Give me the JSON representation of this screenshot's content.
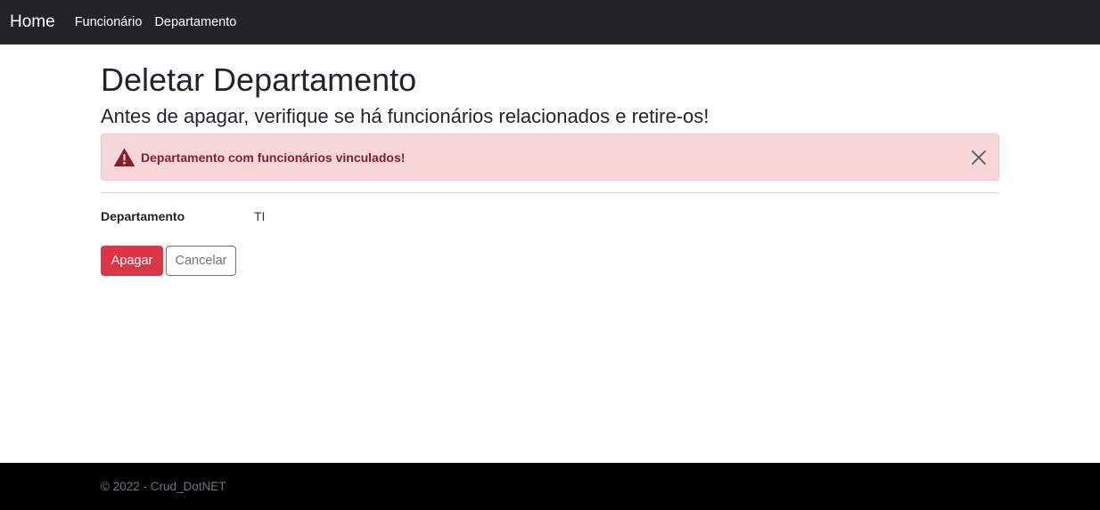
{
  "navbar": {
    "brand": "Home",
    "links": [
      "Funcionário",
      "Departamento"
    ]
  },
  "page": {
    "title": "Deletar Departamento",
    "subtitle": "Antes de apagar, verifique se há funcionários relacionados e retire-os!"
  },
  "alert": {
    "message": "Departamento com funcionários vinculados!",
    "icon": "warning-triangle-icon",
    "color": "#842029",
    "background": "#f8d7da"
  },
  "details": {
    "label": "Departamento",
    "value": "TI"
  },
  "actions": {
    "delete_label": "Apagar",
    "cancel_label": "Cancelar",
    "danger_color": "#dc3545"
  },
  "footer": {
    "text": "© 2022 - Crud_DotNET"
  }
}
